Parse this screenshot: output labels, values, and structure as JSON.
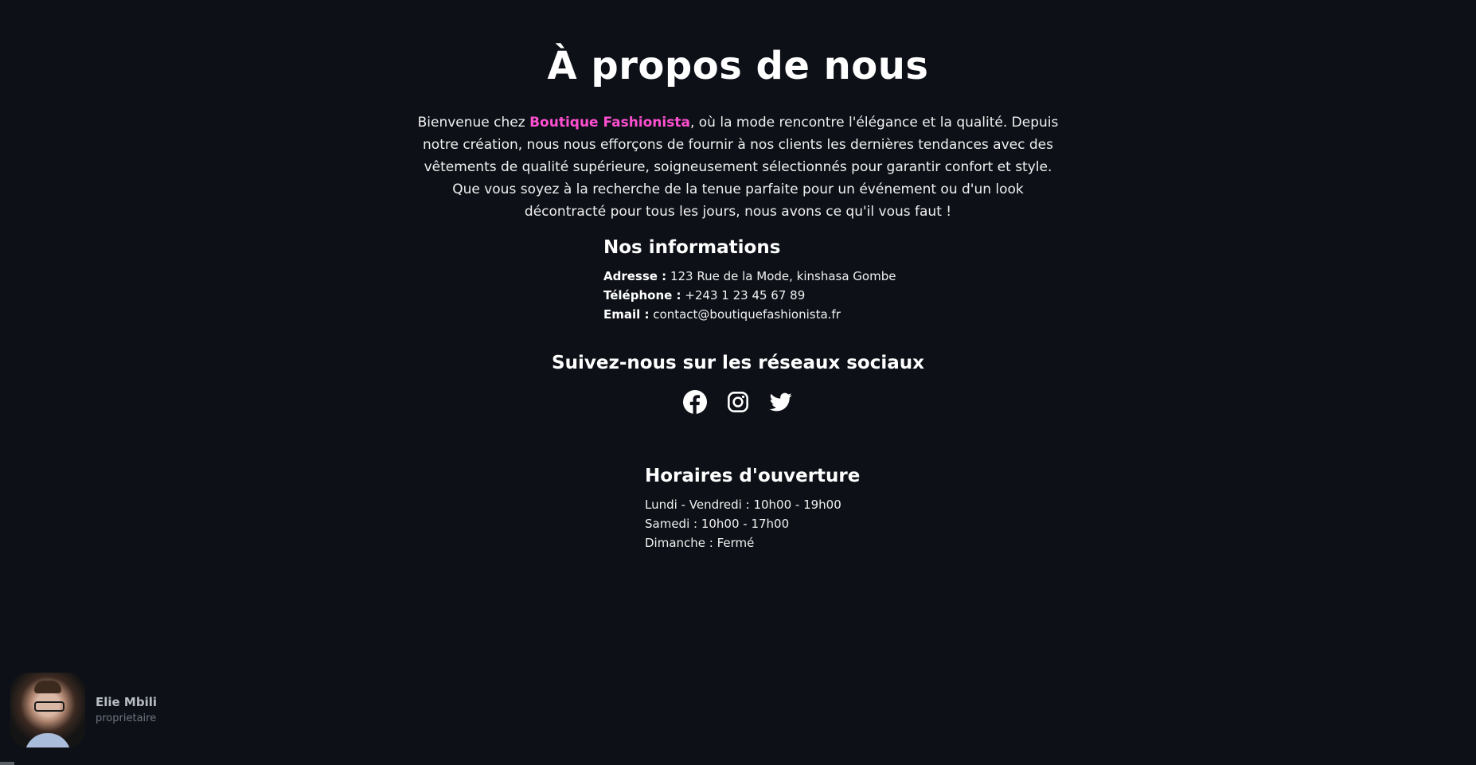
{
  "page": {
    "title": "À propos de nous",
    "intro_prefix": "Bienvenue chez ",
    "brand": "Boutique Fashionista",
    "intro_suffix": ", où la mode rencontre l'élégance et la qualité. Depuis notre création, nous nous efforçons de fournir à nos clients les dernières tendances avec des vêtements de qualité supérieure, soigneusement sélectionnés pour garantir confort et style. Que vous soyez à la recherche de la tenue parfaite pour un événement ou d'un look décontracté pour tous les jours, nous avons ce qu'il vous faut !"
  },
  "info": {
    "heading": "Nos informations",
    "address_label": "Adresse :",
    "address_value": "123 Rue de la Mode, kinshasa Gombe",
    "phone_label": "Téléphone :",
    "phone_value": "+243 1 23 45 67 89",
    "email_label": "Email :",
    "email_value": "contact@boutiquefashionista.fr"
  },
  "social": {
    "heading": "Suivez-nous sur les réseaux sociaux",
    "icons": [
      "facebook-icon",
      "instagram-icon",
      "twitter-icon"
    ]
  },
  "hours": {
    "heading": "Horaires d'ouverture",
    "lines": [
      "Lundi - Vendredi : 10h00 - 19h00",
      "Samedi : 10h00 - 17h00",
      "Dimanche : Fermé"
    ]
  },
  "owner": {
    "name": "Elie Mbili",
    "role": "proprietaire"
  },
  "colors": {
    "background": "#0d1117",
    "brand": "#ff4fd1",
    "text": "#ffffff"
  }
}
